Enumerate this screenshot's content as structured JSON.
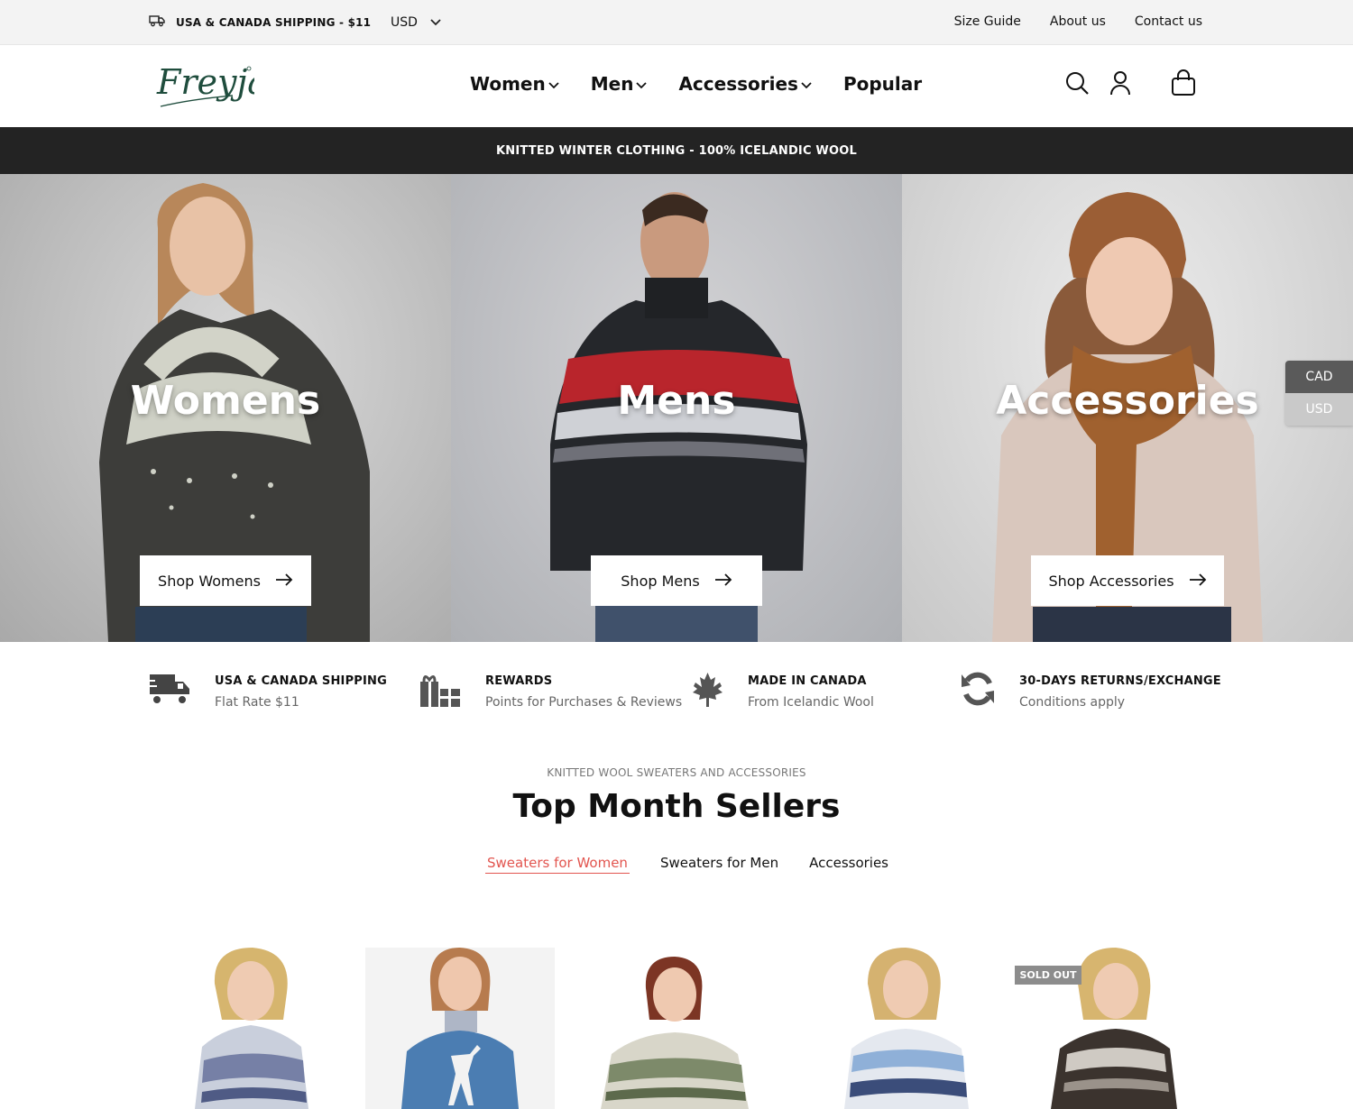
{
  "topbar": {
    "shipping": "USA & CANADA SHIPPING - $11",
    "currency": "USD",
    "links": [
      "Size Guide",
      "About us",
      "Contact us"
    ]
  },
  "header": {
    "logo_text": "Freyja",
    "nav": [
      {
        "label": "Women",
        "dropdown": true
      },
      {
        "label": "Men",
        "dropdown": true
      },
      {
        "label": "Accessories",
        "dropdown": true
      },
      {
        "label": "Popular",
        "dropdown": false
      }
    ],
    "icons": [
      "search-icon",
      "account-icon",
      "cart-icon"
    ]
  },
  "announcement": "KNITTED WINTER CLOTHING - 100% ICELANDIC WOOL",
  "hero": [
    {
      "title": "Womens",
      "button": "Shop Womens"
    },
    {
      "title": "Mens",
      "button": "Shop Mens"
    },
    {
      "title": "Accessories",
      "button": "Shop Accessories"
    }
  ],
  "currency_switcher": {
    "options": [
      "CAD",
      "USD"
    ],
    "selected": "CAD"
  },
  "features": [
    {
      "icon": "truck-icon",
      "title": "USA & CANADA SHIPPING",
      "subtitle": "Flat Rate $11"
    },
    {
      "icon": "gift-icon",
      "title": "REWARDS",
      "subtitle": "Points for Purchases & Reviews"
    },
    {
      "icon": "maple-leaf-icon",
      "title": "MADE IN CANADA",
      "subtitle": "From Icelandic Wool"
    },
    {
      "icon": "refresh-icon",
      "title": "30-DAYS RETURNS/EXCHANGE",
      "subtitle": "Conditions apply"
    }
  ],
  "section": {
    "eyebrow": "KNITTED WOOL SWEATERS AND ACCESSORIES",
    "title": "Top Month Sellers",
    "tabs": [
      "Sweaters for Women",
      "Sweaters for Men",
      "Accessories"
    ],
    "active_tab": "Sweaters for Women"
  },
  "products": {
    "sold_out_label": "SOLD OUT"
  },
  "colors": {
    "accent": "#e2554f",
    "dark": "#232323"
  }
}
